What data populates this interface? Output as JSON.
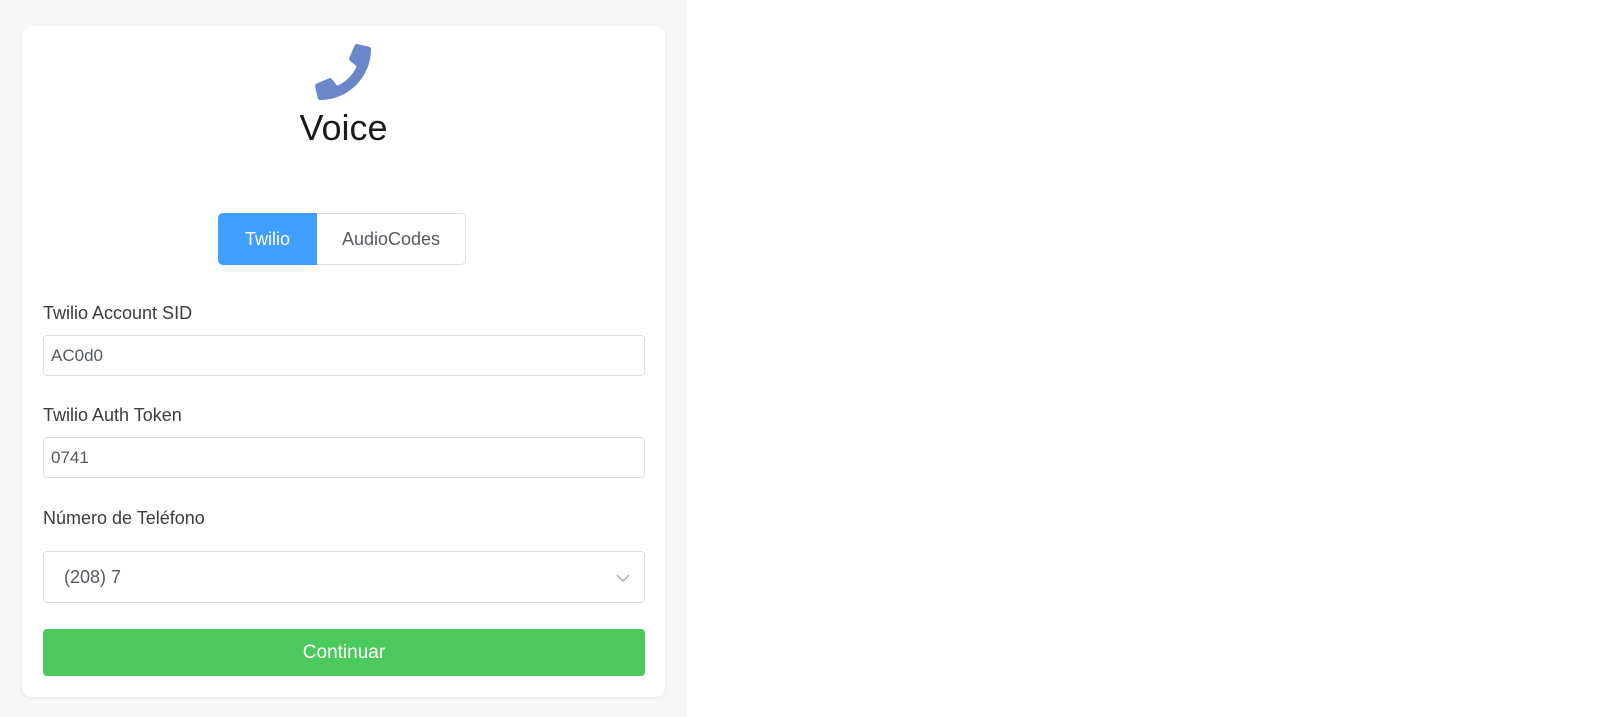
{
  "header": {
    "title": "Voice",
    "icon": "phone-icon",
    "icon_color": "#6b87c9"
  },
  "provider_tabs": [
    {
      "label": "Twilio",
      "selected": true
    },
    {
      "label": "AudioCodes",
      "selected": false
    }
  ],
  "form": {
    "account_sid": {
      "label": "Twilio Account SID",
      "value": "AC0d0"
    },
    "auth_token": {
      "label": "Twilio Auth Token",
      "value": "0741"
    },
    "phone_number": {
      "label": "Número de Teléfono",
      "selected": "(208) 7",
      "icon": "chevron-down-icon"
    }
  },
  "actions": {
    "continue_label": "Continuar"
  },
  "colors": {
    "accent": "#409eff",
    "primary_button": "#4cc95c",
    "page_background": "#f6f8fa"
  }
}
